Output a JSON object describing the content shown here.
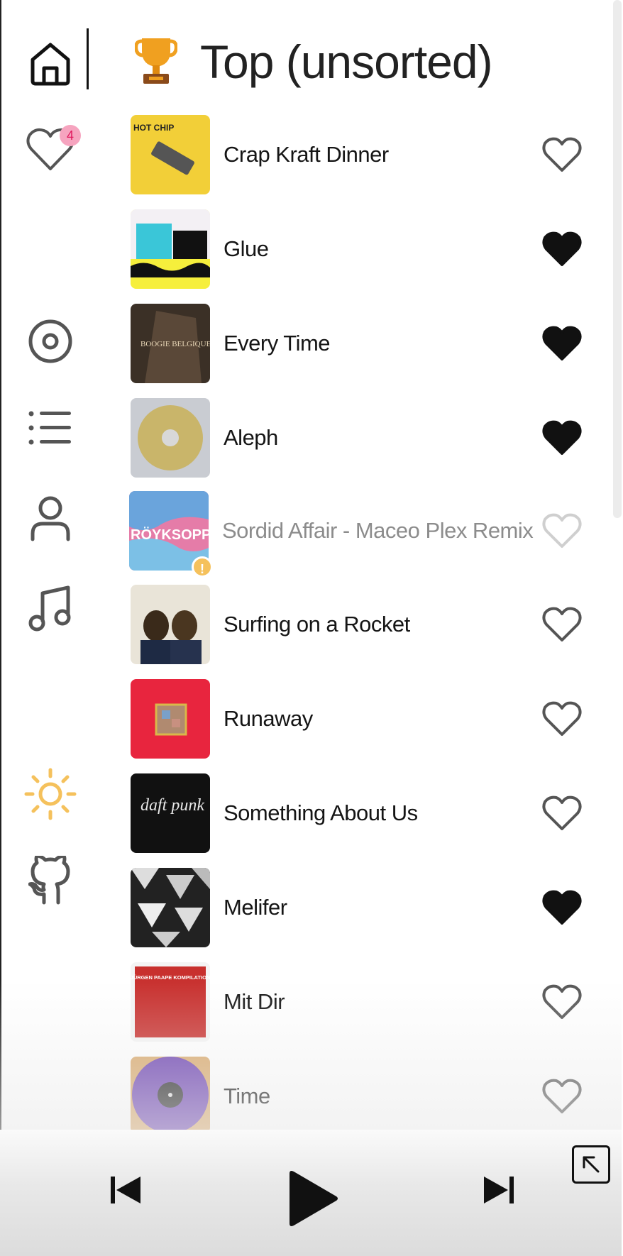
{
  "header": {
    "title": "Top (unsorted)"
  },
  "sidebar": {
    "favorites_count": "4"
  },
  "songs": [
    {
      "title": "Crap Kraft Dinner",
      "liked": false,
      "cover_text": "HOT CHIP"
    },
    {
      "title": "Glue",
      "liked": true
    },
    {
      "title": "Every Time",
      "liked": true,
      "cover_text": "BOOGIE BELGIQUE"
    },
    {
      "title": "Aleph",
      "liked": true
    },
    {
      "title": "Sordid Affair - Maceo Plex Remix",
      "liked": false,
      "unavailable": true,
      "cover_text": "RÖYKSOPP"
    },
    {
      "title": "Surfing on a Rocket",
      "liked": false
    },
    {
      "title": "Runaway",
      "liked": false
    },
    {
      "title": "Something About Us",
      "liked": false,
      "cover_text": "daft punk"
    },
    {
      "title": "Melifer",
      "liked": true
    },
    {
      "title": "Mit Dir",
      "liked": false,
      "cover_text": "JÜRGEN PAAPE KOMPILATION"
    },
    {
      "title": "Time",
      "liked": false
    }
  ],
  "player": {},
  "colors": {
    "badge_bg": "#f6a4bf",
    "badge_text": "#e0195e",
    "sun": "#f5c15c"
  }
}
